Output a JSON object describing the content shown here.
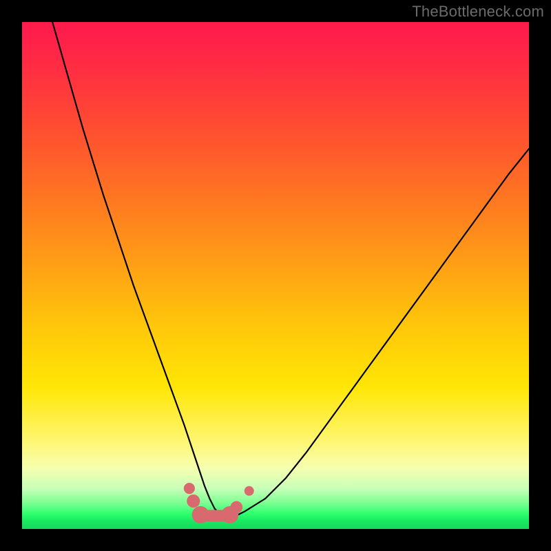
{
  "watermark": {
    "text": "TheBottleneck.com"
  },
  "colors": {
    "curve": "#000000",
    "marker_fill": "#d86a6f",
    "marker_stroke": "#8e3a3f",
    "frame": "#000000"
  },
  "chart_data": {
    "type": "line",
    "title": "",
    "xlabel": "",
    "ylabel": "",
    "xlim": [
      0,
      100
    ],
    "ylim": [
      0,
      100
    ],
    "grid": false,
    "note": "Axes are unlabeled in the source image; values are normalized estimates (0–100) read from pixel positions. y ≈ bottleneck percentage, x ≈ relative hardware capability.",
    "series": [
      {
        "name": "bottleneck-curve",
        "x": [
          6,
          8,
          10,
          12,
          14,
          16,
          18,
          20,
          22,
          24,
          26,
          28,
          30,
          32,
          33,
          34,
          35,
          36,
          37,
          38,
          39,
          40,
          42,
          44,
          48,
          52,
          56,
          60,
          64,
          68,
          72,
          76,
          80,
          84,
          88,
          92,
          96,
          100
        ],
        "y": [
          100,
          93,
          86,
          79,
          72.5,
          66,
          60,
          54,
          48,
          42.5,
          37,
          31.5,
          26,
          20.5,
          17.5,
          14.5,
          11.5,
          8.5,
          6,
          4,
          3,
          2.5,
          2.5,
          3.5,
          6,
          10,
          15,
          20.5,
          26,
          31.5,
          37,
          42.5,
          48,
          53.5,
          59,
          64.5,
          70,
          75
        ]
      }
    ],
    "markers": [
      {
        "name": "flat-min-segment",
        "shape": "capsule",
        "x_start": 35.2,
        "x_end": 41.0,
        "y": 2.6,
        "thickness_pct": 2.3
      },
      {
        "name": "left-bead-1",
        "shape": "circle",
        "x": 33.0,
        "y": 8.0,
        "r_pct": 1.1
      },
      {
        "name": "left-bead-2",
        "shape": "circle",
        "x": 33.8,
        "y": 5.5,
        "r_pct": 1.3
      },
      {
        "name": "left-lobe",
        "shape": "circle",
        "x": 35.2,
        "y": 2.8,
        "r_pct": 1.7
      },
      {
        "name": "right-lobe",
        "shape": "circle",
        "x": 41.0,
        "y": 2.8,
        "r_pct": 1.7
      },
      {
        "name": "right-bead-1",
        "shape": "circle",
        "x": 42.3,
        "y": 4.3,
        "r_pct": 1.2
      },
      {
        "name": "right-bead-2",
        "shape": "circle",
        "x": 44.8,
        "y": 7.5,
        "r_pct": 0.95
      }
    ]
  }
}
